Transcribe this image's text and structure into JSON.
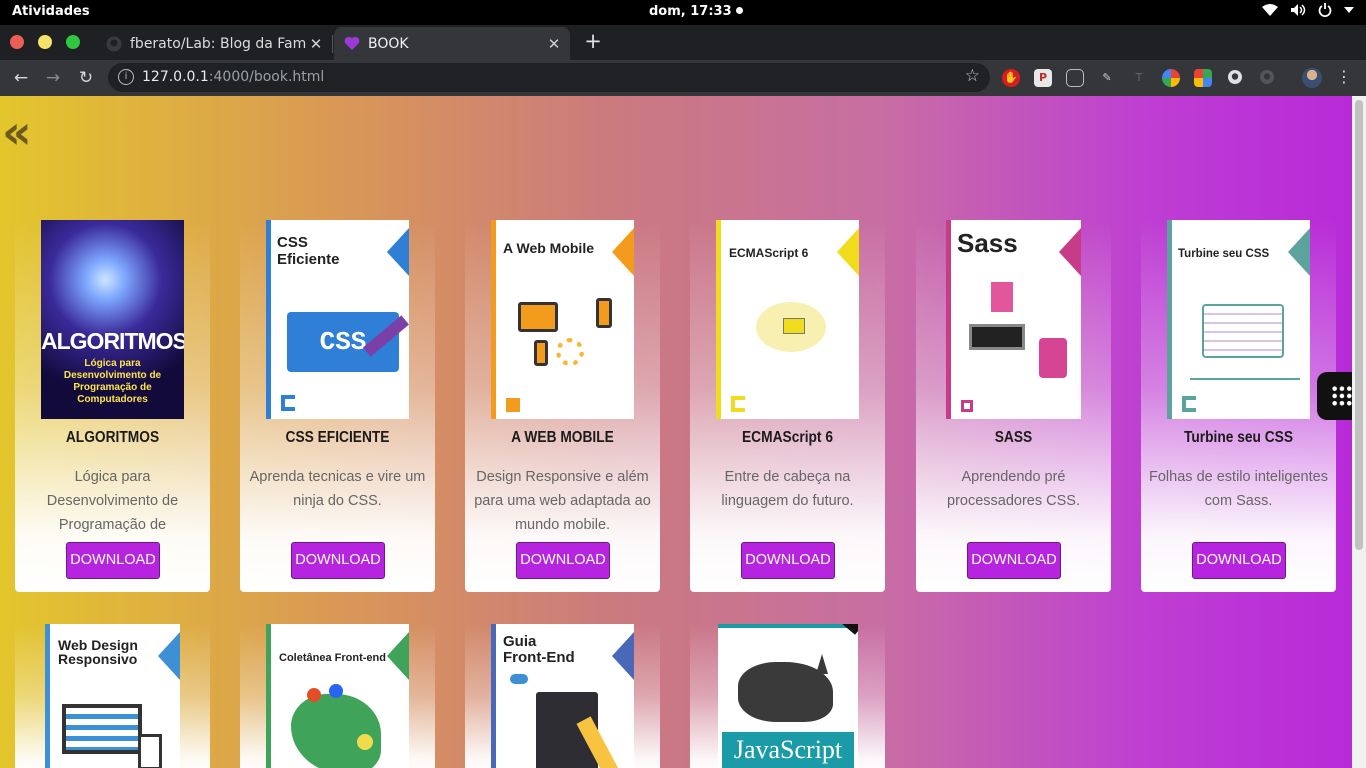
{
  "os": {
    "activities": "Atividades",
    "clock": "dom, 17:33"
  },
  "browser": {
    "tabs": [
      {
        "title": "fberato/Lab: Blog da Fam",
        "favicon": "github-icon"
      },
      {
        "title": "BOOK",
        "favicon": "purple-heart-icon"
      }
    ],
    "url_host": "127.0.0.1",
    "url_path": ":4000/book.html"
  },
  "page": {
    "back_icon": "«",
    "download_label": "DOWNLOAD",
    "books": [
      {
        "title": "ALGORITMOS",
        "desc": "Lógica para Desenvolvimento de Programação de Computadores",
        "cover_title": "ALGORITMOS",
        "cover_sub": "Lógica para Desenvolvimento de Programação de Computadores"
      },
      {
        "title": "CSS EFICIENTE",
        "desc": "Aprenda tecnicas e vire um ninja do CSS.",
        "cover_title": "CSS Eficiente",
        "cover_art": "CSS"
      },
      {
        "title": "A WEB MOBILE",
        "desc": "Design Responsive e além para uma web adaptada ao mundo mobile.",
        "cover_title": "A Web Mobile"
      },
      {
        "title": "ECMAScript 6",
        "desc": "Entre de cabeça na linguagem do futuro.",
        "cover_title": "ECMAScript 6"
      },
      {
        "title": "SASS",
        "desc": "Aprendendo pré processadores CSS.",
        "cover_title": "Sass"
      },
      {
        "title": "Turbine seu CSS",
        "desc": "Folhas de estilo inteligentes com Sass.",
        "cover_title": "Turbine seu CSS"
      }
    ],
    "books_row2": [
      {
        "cover_title": "Web Design Responsivo"
      },
      {
        "cover_title": "Coletânea Front-end"
      },
      {
        "cover_title": "Guia Front-End"
      },
      {
        "cover_title": "JavaScript"
      }
    ]
  },
  "colors": {
    "button": "#b724e0",
    "gradient_left": "#e3c62c",
    "gradient_right": "#b82ad8"
  }
}
